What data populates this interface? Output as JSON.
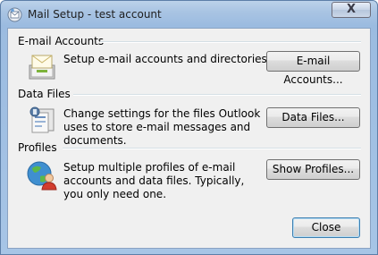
{
  "window": {
    "title": "Mail Setup - test account",
    "close_glyph": "X"
  },
  "groups": [
    {
      "heading": "E-mail Accounts",
      "description": "Setup e-mail accounts and directories.",
      "button": "E-mail Accounts...",
      "icon": "email-accounts-icon"
    },
    {
      "heading": "Data Files",
      "description": "Change settings for the files Outlook uses to store e-mail messages and documents.",
      "button": "Data Files...",
      "icon": "data-files-icon"
    },
    {
      "heading": "Profiles",
      "description": "Setup multiple profiles of e-mail accounts and data files. Typically, you only need one.",
      "button": "Show Profiles...",
      "icon": "profiles-icon"
    }
  ],
  "footer": {
    "close_button": "Close"
  }
}
